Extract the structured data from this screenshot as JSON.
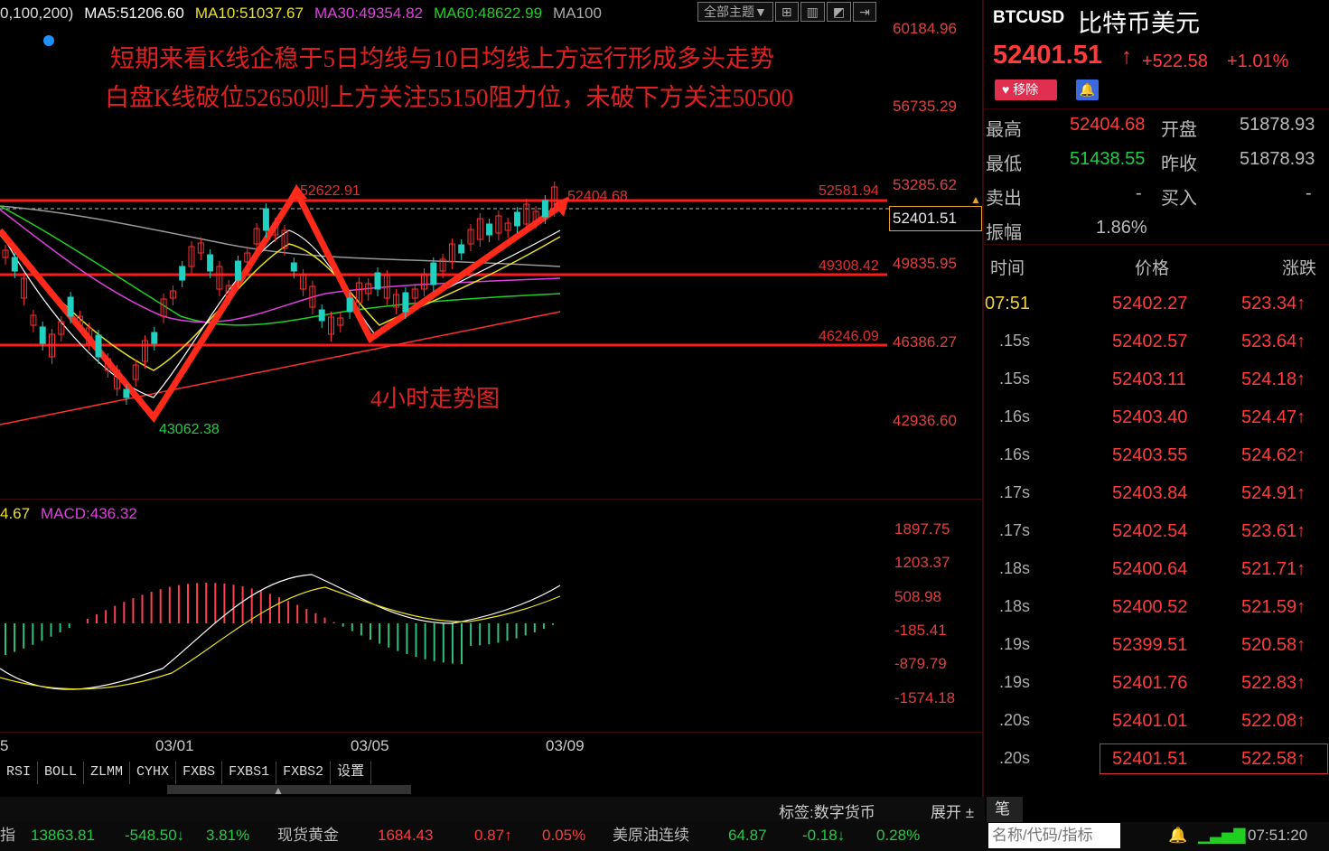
{
  "chart": {
    "legend": [
      {
        "text": "0,100,200)",
        "color": "#dddddd"
      },
      {
        "text": "MA5:51206.60",
        "color": "#ffffff"
      },
      {
        "text": "MA10:51037.67",
        "color": "#e8e020"
      },
      {
        "text": "MA30:49354.82",
        "color": "#e040e0"
      },
      {
        "text": "MA60:48622.99",
        "color": "#20d020"
      },
      {
        "text": "MA100",
        "color": "#aaaaaa"
      }
    ],
    "toolbar": {
      "theme_label": "全部主题▼",
      "icons": [
        "grid-icon",
        "layout-icon",
        "chart-icon",
        "expand-icon"
      ]
    },
    "annotation_line1": "短期来看K线企稳于5日均线与10日均线上方运行形成多头走势",
    "annotation_line2": "白盘K线破位52650则上方关注55150阻力位，未破下方关注50500",
    "annotation_caption": "4小时走势图",
    "price_axis": [
      "60184.96",
      "56735.29",
      "53285.62",
      "49835.95",
      "46386.27",
      "42936.60"
    ],
    "levels": [
      "52581.94",
      "49308.42",
      "46246.09"
    ],
    "peak_labels": [
      "52622.91",
      "52404.68",
      "43062.38"
    ],
    "current_price": "52401.51",
    "macd_legend": {
      "left": "4.67",
      "macd": "MACD:436.32"
    },
    "macd_axis": [
      "1897.75",
      "1203.37",
      "508.98",
      "-185.41",
      "-879.79",
      "-1574.18"
    ],
    "date_axis": [
      "5",
      "03/01",
      "03/05",
      "03/09"
    ],
    "indicator_tabs": [
      "RSI",
      "BOLL",
      "ZLMM",
      "CYHX",
      "FXBS",
      "FXBS1",
      "FXBS2",
      "设置"
    ],
    "tag_label": "标签:数字货币",
    "expand_label": "展开 ±",
    "pen_label": "笔"
  },
  "quote": {
    "symbol": "BTCUSD",
    "name": "比特币美元",
    "price": "52401.51",
    "arrow": "↑",
    "change": "+522.58",
    "change_pct": "+1.01%",
    "remove_label": "移除",
    "stats": [
      {
        "label": "最高",
        "value": "52404.68",
        "label2": "开盘",
        "value2": "51878.93"
      },
      {
        "label": "最低",
        "value": "51438.55",
        "label2": "昨收",
        "value2": "51878.93"
      },
      {
        "label": "卖出",
        "value": "-",
        "label2": "买入",
        "value2": "-"
      },
      {
        "label": "振幅",
        "value": "1.86%",
        "label2": "",
        "value2": ""
      }
    ],
    "tick_headers": [
      "时间",
      "价格",
      "涨跌"
    ],
    "ticks": [
      {
        "time": "07:51",
        "price": "52402.27",
        "chg": "523.34"
      },
      {
        "time": ".15s",
        "price": "52402.57",
        "chg": "523.64"
      },
      {
        "time": ".15s",
        "price": "52403.11",
        "chg": "524.18"
      },
      {
        "time": ".16s",
        "price": "52403.40",
        "chg": "524.47"
      },
      {
        "time": ".16s",
        "price": "52403.55",
        "chg": "524.62"
      },
      {
        "time": ".17s",
        "price": "52403.84",
        "chg": "524.91"
      },
      {
        "time": ".17s",
        "price": "52402.54",
        "chg": "523.61"
      },
      {
        "time": ".18s",
        "price": "52400.64",
        "chg": "521.71"
      },
      {
        "time": ".18s",
        "price": "52400.52",
        "chg": "521.59"
      },
      {
        "time": ".19s",
        "price": "52399.51",
        "chg": "520.58"
      },
      {
        "time": ".19s",
        "price": "52401.76",
        "chg": "522.83"
      },
      {
        "time": ".20s",
        "price": "52401.01",
        "chg": "522.08"
      },
      {
        "time": ".20s",
        "price": "52401.51",
        "chg": "522.58"
      }
    ]
  },
  "statusbar": {
    "left": "指",
    "v1": "13863.81",
    "v2": "-548.50↓",
    "v3": "3.81%",
    "gold_label": "现货黄金",
    "gold_price": "1684.43",
    "gold_chg": "0.87↑",
    "gold_pct": "0.05%",
    "oil_label": "美原油连续",
    "oil_price": "64.87",
    "oil_chg": "-0.18↓",
    "oil_pct": "0.28%",
    "search_placeholder": "名称/代码/指标",
    "time": "07:51:20"
  }
}
